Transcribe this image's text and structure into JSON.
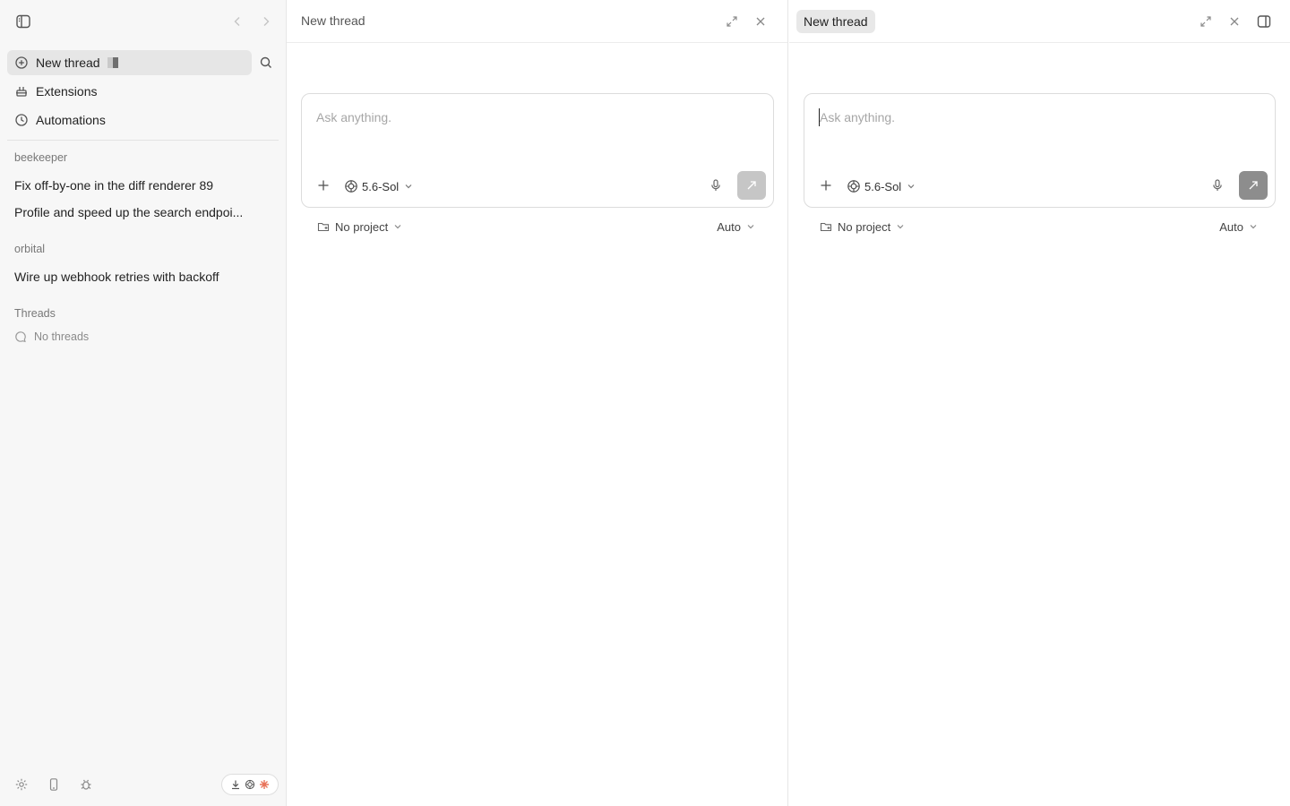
{
  "sidebar": {
    "nav": [
      {
        "label": "New thread",
        "icon": "new-thread-icon",
        "active": true
      },
      {
        "label": "Extensions",
        "icon": "extensions-icon"
      },
      {
        "label": "Automations",
        "icon": "clock-icon"
      }
    ],
    "groups": [
      {
        "label": "beekeeper",
        "threads": [
          "Fix off-by-one in the diff renderer 89",
          "Profile and speed up the search endpoi..."
        ]
      },
      {
        "label": "orbital",
        "threads": [
          "Wire up webhook retries with backoff"
        ]
      },
      {
        "label": "Threads",
        "empty": "No threads"
      }
    ],
    "bottom_icons": [
      "settings-icon",
      "phone-icon",
      "bug-icon"
    ],
    "status_icons": [
      "download-icon",
      "openai-icon",
      "sparkle-icon"
    ],
    "status_accent": "#e8735a"
  },
  "panes": [
    {
      "title": "New thread",
      "composer": {
        "placeholder": "Ask anything.",
        "model": "5.6-Sol"
      },
      "project": "No project",
      "mode": "Auto"
    },
    {
      "title": "New thread",
      "composer": {
        "placeholder": "Ask anything.",
        "model": "5.6-Sol"
      },
      "project": "No project",
      "mode": "Auto"
    }
  ]
}
